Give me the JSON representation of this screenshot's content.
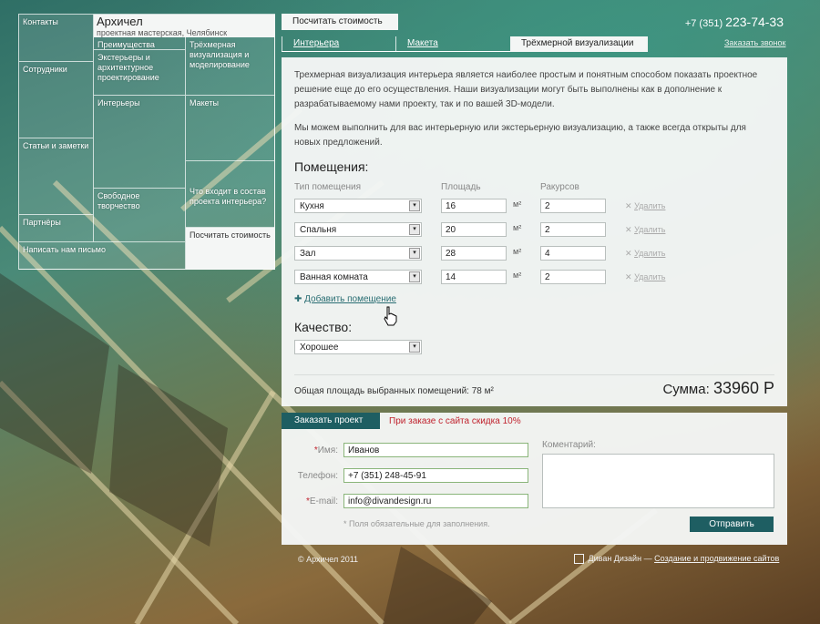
{
  "brand": {
    "name": "Архичел",
    "subtitle": "проектная мастерская, Челябинск"
  },
  "menu": {
    "contacts": "Контакты",
    "staff": "Сотрудники",
    "articles": "Статьи и заметки",
    "partners": "Партнёры",
    "write_us": "Написать нам письмо",
    "advantages": "Преимущества",
    "exteriors": "Экстерьеры и архитектурное проектирование",
    "interiors": "Интерьеры",
    "free_creativity": "Свободное творчество",
    "visualization": "Трёхмерная визуализация и моделирование",
    "models": "Макеты",
    "design_project": "Что входит в состав проекта интерьера?",
    "calc_cost": "Посчитать стоимость"
  },
  "header": {
    "calc_tab": "Посчитать стоимость",
    "phone_prefix": "+7 (351)",
    "phone_number": "223-74-33",
    "callback": "Заказать звонок"
  },
  "tabs": [
    {
      "label": "Интерьера"
    },
    {
      "label": "Макета"
    },
    {
      "label": "Трёхмерной визуализации"
    }
  ],
  "intro": {
    "p1": "Трехмерная визуализация интерьера является наиболее простым и понятным способом показать проектное решение еще до его осуществления. Наши визуализации могут быть выполнены как в дополнение к разрабатываемому нами проекту, так и по вашей 3D-модели.",
    "p2": "Мы можем выполнить для вас интерьерную или экстерьерную визуализацию, а также всегда открыты для новых предложений."
  },
  "rooms": {
    "heading": "Помещения:",
    "col_type": "Тип помещения",
    "col_area": "Площадь",
    "col_views": "Ракурсов",
    "unit": "м²",
    "delete_label": "Удалить",
    "items": [
      {
        "type": "Кухня",
        "area": "16",
        "views": "2"
      },
      {
        "type": "Спальня",
        "area": "20",
        "views": "2"
      },
      {
        "type": "Зал",
        "area": "28",
        "views": "4"
      },
      {
        "type": "Ванная комната",
        "area": "14",
        "views": "2"
      }
    ],
    "add_label": "Добавить помещение"
  },
  "quality": {
    "heading": "Качество:",
    "value": "Хорошее"
  },
  "summary": {
    "total_label": "Общая площадь выбранных помещений: 78 м²",
    "sum_label": "Сумма:",
    "sum_value": "33960 Р"
  },
  "order": {
    "tab": "Заказать проект",
    "discount": "При заказе с сайта скидка 10%",
    "name_label": "Имя:",
    "name_value": "Иванов",
    "phone_label": "Телефон:",
    "phone_value": "+7 (351) 248-45-91",
    "email_label": "E-mail:",
    "email_value": "info@divandesign.ru",
    "required_note": "* Поля обязательные для заполнения.",
    "comment_label": "Коментарий:",
    "submit": "Отправить",
    "asterisk": "*"
  },
  "footer": {
    "copyright": "© Архичел 2011",
    "studio": "Диван Дизайн",
    "dash": "—",
    "link": "Создание и продвижение сайтов"
  },
  "icons": {
    "dropdown_arrow": "▾",
    "delete": "✕",
    "add": "✚"
  }
}
